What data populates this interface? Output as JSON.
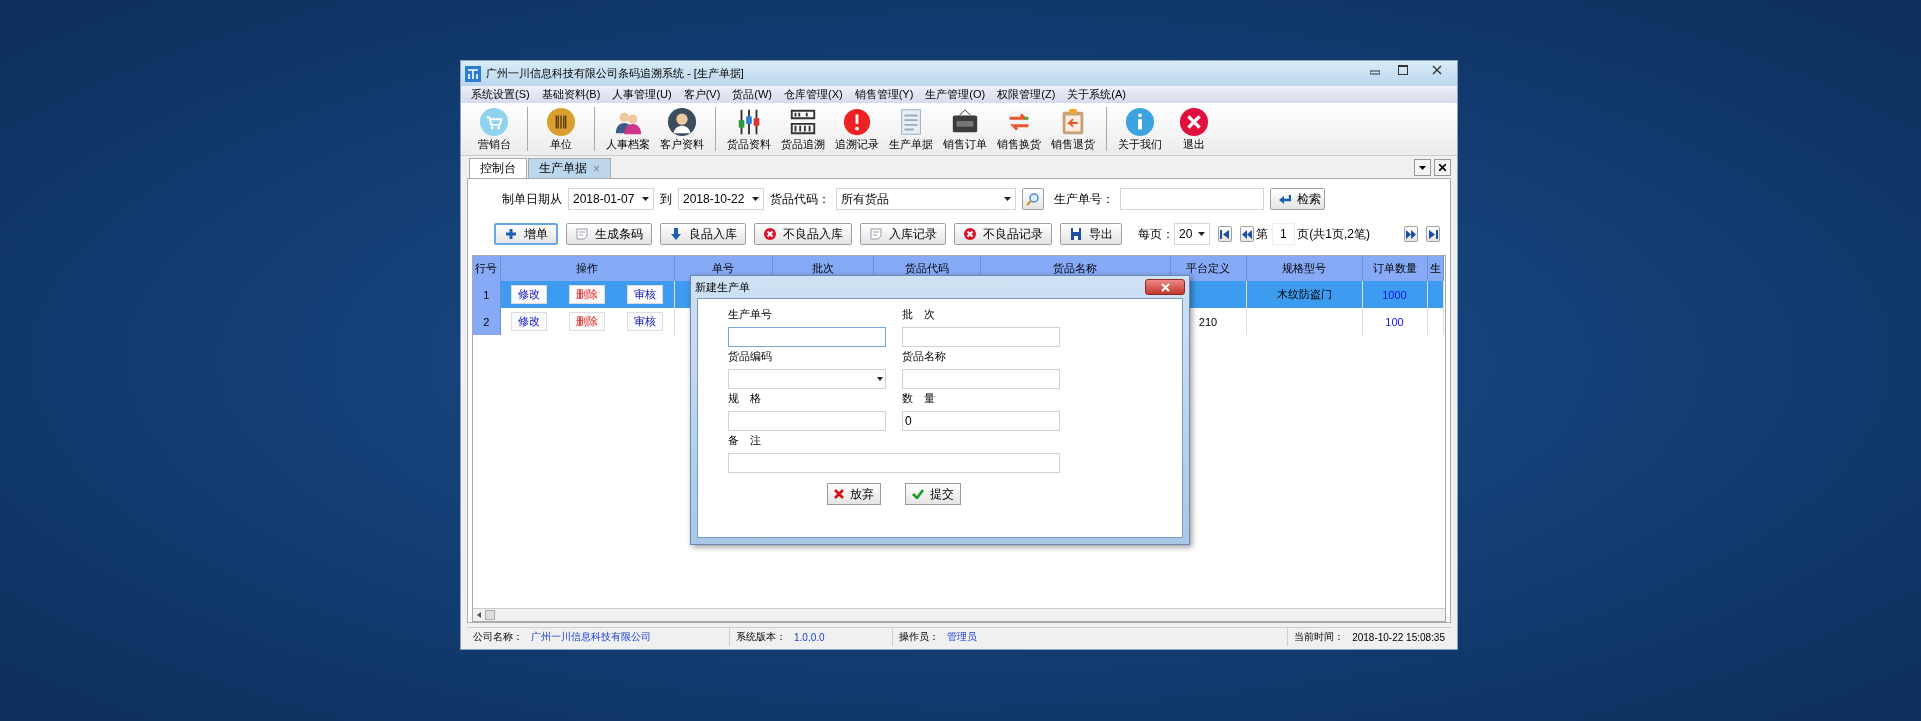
{
  "window": {
    "title": "广州一川信息科技有限公司条码追溯系统 - [生产单据]"
  },
  "menu": [
    "系统设置(S)",
    "基础资料(B)",
    "人事管理(U)",
    "客户(V)",
    "货品(W)",
    "仓库管理(X)",
    "销售管理(Y)",
    "生产管理(O)",
    "权限管理(Z)",
    "关于系统(A)"
  ],
  "toolbar": [
    [
      {
        "label": "营销台"
      }
    ],
    [
      {
        "label": "单位"
      }
    ],
    [
      {
        "label": "人事档案"
      },
      {
        "label": "客户资料"
      }
    ],
    [
      {
        "label": "货品资料"
      },
      {
        "label": "货品追溯"
      },
      {
        "label": "追溯记录"
      },
      {
        "label": "生产单据"
      },
      {
        "label": "销售订单"
      },
      {
        "label": "销售换货"
      },
      {
        "label": "销售退货"
      }
    ],
    [
      {
        "label": "关于我们"
      },
      {
        "label": "退出"
      }
    ]
  ],
  "tabs": [
    {
      "label": "控制台",
      "selected": false
    },
    {
      "label": "生产单据",
      "selected": true,
      "close_glyph": "×"
    }
  ],
  "filter": {
    "date_from_label": "制单日期从",
    "date_from": "2018-01-07",
    "date_to_label": "到",
    "date_to": "2018-10-22",
    "product_label": "货品代码：",
    "product": "所有货品",
    "order_no_label": "生产单号：",
    "search_button": "检索"
  },
  "actions": [
    {
      "label": "增单"
    },
    {
      "label": "生成条码"
    },
    {
      "label": "良品入库"
    },
    {
      "label": "不良品入库"
    },
    {
      "label": "入库记录"
    },
    {
      "label": "不良品记录"
    },
    {
      "label": "导出"
    }
  ],
  "pager": {
    "per_page_label": "每页：",
    "per_page": "20",
    "page_prefix": "第",
    "page": "1",
    "page_suffix": "页(共1页,2笔)"
  },
  "table": {
    "columns": [
      {
        "label": "行号",
        "kind": "row_no"
      },
      {
        "label": "操作",
        "kind": "actions"
      },
      {
        "label": "单号",
        "kind": "order_no"
      },
      {
        "label": "批次",
        "kind": "batch"
      },
      {
        "label": "货品代码",
        "kind": "code"
      },
      {
        "label": "货品名称",
        "kind": "name"
      },
      {
        "label": "平台定义",
        "kind": "platform"
      },
      {
        "label": "规格型号",
        "kind": "spec"
      },
      {
        "label": "订单数量",
        "kind": "qty"
      },
      {
        "label": "生",
        "kind": "column_10"
      }
    ],
    "rows": [
      {
        "selected": true,
        "row_no": "1",
        "actions": [
          {
            "label": "修改",
            "kind": "edit"
          },
          {
            "label": "删除",
            "kind": "delete"
          },
          {
            "label": "审核",
            "kind": "audit"
          }
        ],
        "spec": "木纹防盗门",
        "qty": "1000"
      },
      {
        "selected": false,
        "row_no": "2",
        "actions": [
          {
            "label": "修改",
            "kind": "edit"
          },
          {
            "label": "删除",
            "kind": "delete"
          },
          {
            "label": "审核",
            "kind": "audit"
          }
        ],
        "platform": "210",
        "qty": "100"
      }
    ]
  },
  "dialog": {
    "title": "新建生产单",
    "fields": [
      {
        "label": "生产单号",
        "kind": "text",
        "focused": true
      },
      {
        "label": "批　次",
        "kind": "text",
        "focused": false
      },
      {
        "label": "货品编码",
        "kind": "select",
        "focused": false
      },
      {
        "label": "货品名称",
        "kind": "text",
        "focused": false
      },
      {
        "label": "规　格",
        "kind": "text",
        "focused": false
      },
      {
        "label": "数　量",
        "kind": "text",
        "focused": false,
        "value": "0"
      },
      {
        "label": "备　注",
        "kind": "textarea",
        "focused": false
      }
    ],
    "buttons": [
      {
        "label": "放弃",
        "kind": "cancel"
      },
      {
        "label": "提交",
        "kind": "submit"
      }
    ]
  },
  "status_bar": [
    {
      "label": "公司名称：",
      "value": "广州一川信息科技有限公司",
      "highlight": true
    },
    {
      "label": "系统版本：",
      "value": "1.0.0.0",
      "highlight": true
    },
    {
      "label": "操作员：",
      "value": "管理员",
      "highlight": true
    },
    {
      "label": "当前时间：",
      "value": "2018-10-22 15:08:35",
      "highlight": false
    }
  ]
}
